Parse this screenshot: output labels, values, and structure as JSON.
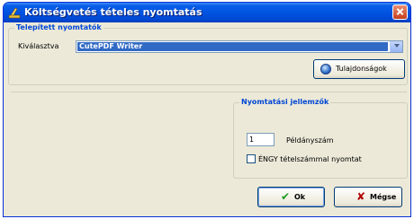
{
  "window": {
    "title": "Költségvetés tételes nyomtatás"
  },
  "printers": {
    "group_title": "Telepített nyomtatók",
    "select_label": "Kiválasztva",
    "selected_printer": "CutePDF Writer",
    "properties_button": "Tulajdonságok"
  },
  "print_settings": {
    "group_title": "Nyomtatási jellemzők",
    "copies_value": "1",
    "copies_label": "Példányszám",
    "engy_checkbox_label": "ÉNGY tételszámmal nyomtat",
    "engy_checked": false
  },
  "actions": {
    "ok": "Ok",
    "cancel": "Mégse"
  },
  "colors": {
    "accent": "#0046d5",
    "titlebar": "#0053e1",
    "selection": "#316ac5"
  },
  "icons": [
    "app-icon",
    "close-icon",
    "chevron-down-icon",
    "properties-icon",
    "check-icon",
    "cancel-x-icon"
  ]
}
